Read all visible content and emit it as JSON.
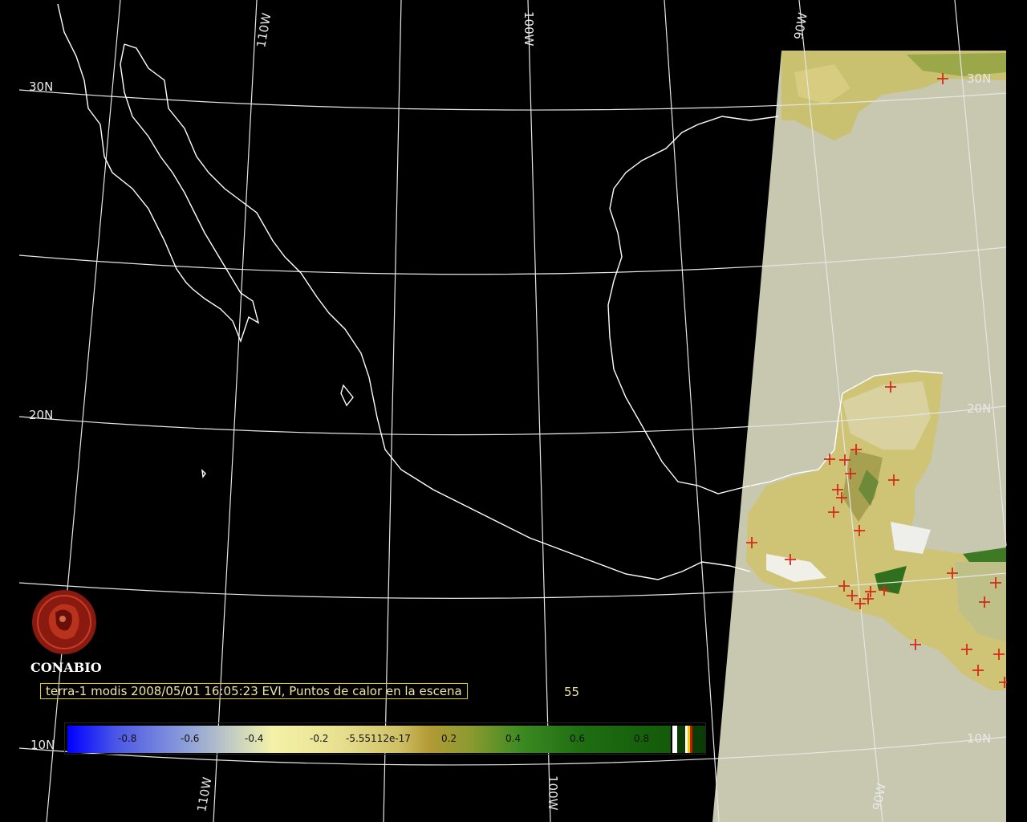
{
  "caption": {
    "text": "terra-1 modis 2008/05/01 16:05:23 EVI, Puntos de calor en la escena",
    "count": "55"
  },
  "logo": {
    "text": "CONABIO"
  },
  "grid_labels": {
    "lon_110w_top": "110W",
    "lon_100w_top": "100W",
    "lon_90w_top": "90W",
    "lat_30n_left": "30N",
    "lat_30n_right": "30N",
    "lat_20n_left": "20N",
    "lat_20n_right": "20N",
    "lat_10n_left": "10N",
    "lat_10n_right": "10N",
    "lon_110w_bottom": "110W",
    "lon_100w_bottom": "100W",
    "lon_90w_bottom": "90W"
  },
  "colorbar": {
    "ticks": [
      "-0.8",
      "-0.6",
      "-0.4",
      "-0.2",
      "-5.55112e-17",
      "0.2",
      "0.4",
      "0.6",
      "0.8"
    ]
  },
  "colors": {
    "background": "#000000",
    "coastline": "#ffffff",
    "graticule": "#e6e6e6",
    "no_data": "#c8c8b0",
    "hotspot": "#d42a1a",
    "caption_border": "#e0d000"
  },
  "hotspots_count_shown": "55"
}
